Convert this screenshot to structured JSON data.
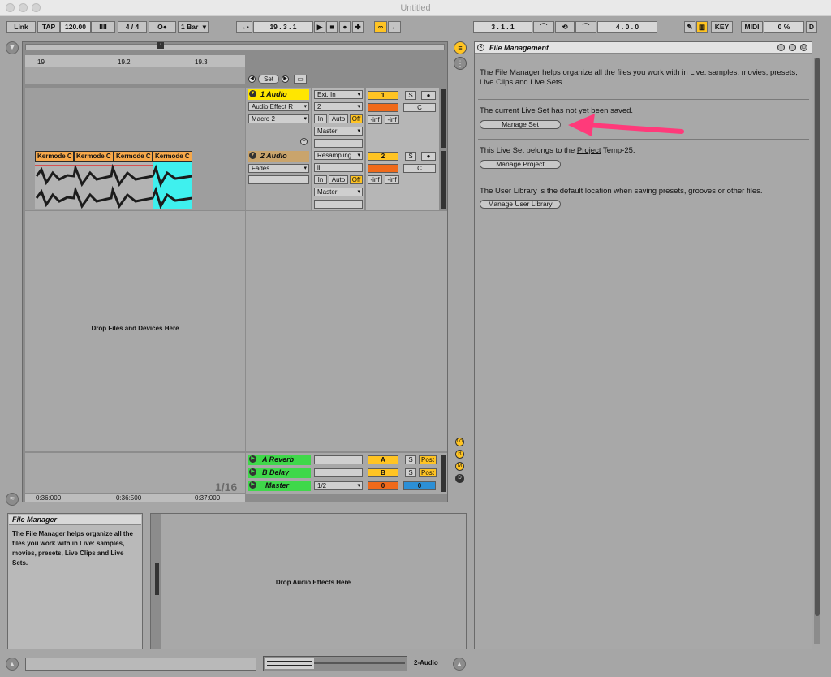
{
  "window": {
    "title": "Untitled"
  },
  "toolbar": {
    "link": "Link",
    "tap": "TAP",
    "tempo": "120.00",
    "metro_bars": "IIII",
    "signature": "4  /  4",
    "rec_dot": "O●",
    "quantize": "1 Bar",
    "follow": "→•",
    "position": "19 .  3 .  1",
    "loop_start": "3 .  1 .  1",
    "loop_len": "4 .  0 .  0",
    "key": "KEY",
    "midi": "MIDI",
    "cpu": "0 %",
    "disk": "D",
    "play": "▶",
    "stop": "■",
    "record": "●",
    "add": "✚"
  },
  "arrangement": {
    "ruler_marks": [
      "19",
      "19.2",
      "19.3"
    ],
    "set_label": "Set",
    "drop_text": "Drop Files and Devices Here",
    "quantize_display": "1/16",
    "time_marks": [
      "0:36:000",
      "0:36:500",
      "0:37:000"
    ],
    "clip_names": [
      "Kermode C",
      "Kermode C",
      "Kermode C",
      "Kermode C"
    ]
  },
  "tracks": [
    {
      "name": "1 Audio",
      "color": "#ffe600",
      "input": "Ext. In",
      "channel": "2",
      "monitor_in": "In",
      "monitor_auto": "Auto",
      "monitor_off": "Off",
      "output": "Master",
      "device1": "Audio Effect R",
      "device2": "Macro 2",
      "num": "1",
      "solo": "S",
      "pan": "C",
      "vol1": "-inf",
      "vol2": "-inf"
    },
    {
      "name": "2 Audio",
      "color": "#f7a84a",
      "input": "Resampling",
      "channel": "ii",
      "monitor_in": "In",
      "monitor_auto": "Auto",
      "monitor_off": "Off",
      "output": "Master",
      "device1": "Fades",
      "num": "2",
      "solo": "S",
      "pan": "C",
      "vol1": "-inf",
      "vol2": "-inf"
    }
  ],
  "returns": [
    {
      "name": "A Reverb",
      "letter": "A",
      "solo": "S",
      "post": "Post"
    },
    {
      "name": "B Delay",
      "letter": "B",
      "solo": "S",
      "post": "Post"
    }
  ],
  "master": {
    "name": "Master",
    "cue": "1/2",
    "vol": "0",
    "pan": "0"
  },
  "io_toggles": [
    "I·O",
    "R",
    "M",
    "D"
  ],
  "file_management": {
    "title": "File Management",
    "intro": "The File Manager helps organize all the files you work with in Live: samples, movies, presets, Live Clips and Live Sets.",
    "not_saved": "The current Live Set has not yet been saved.",
    "manage_set": "Manage Set",
    "belongs_prefix": "This Live Set belongs to the",
    "belongs_link": "Project",
    "belongs_suffix": "Temp-25.",
    "manage_project": "Manage Project",
    "user_lib": "The User Library is the default location when saving presets, grooves or other files.",
    "manage_user_library": "Manage User Library"
  },
  "info_view": {
    "title": "File Manager",
    "body": "The File Manager helps organize all the files you work with in Live: samples, movies, presets, Live Clips and Live Sets."
  },
  "device_view": {
    "drop_text": "Drop Audio Effects Here"
  },
  "status": {
    "track": "2-Audio"
  },
  "colors": {
    "accent": "#ffc423",
    "return_green": "#3fd84a",
    "clip": "#f7a84a",
    "cyan": "#3ff0ee",
    "arrow": "#ff3a7a"
  }
}
